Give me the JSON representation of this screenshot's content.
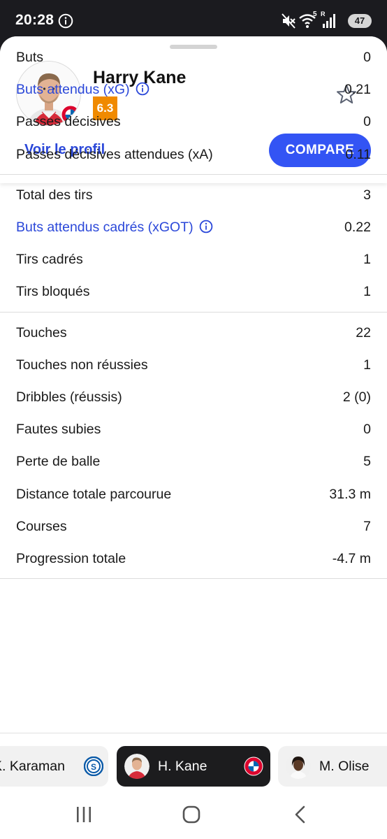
{
  "status_bar": {
    "time": "20:28",
    "battery": "47",
    "network_label": "5",
    "signal_label": "R",
    "icons": [
      "info-icon",
      "mute-icon",
      "wifi-icon",
      "signal-icon",
      "battery-icon"
    ]
  },
  "player": {
    "name": "Harry Kane",
    "rating": "6.3",
    "rating_color": "#f08a00",
    "profile_link": "Voir le profil",
    "compare_label": "COMPARE",
    "favorite_icon": "star-outline-icon"
  },
  "colors": {
    "accent": "#3354f4",
    "link": "#2b48d9",
    "rating_orange": "#f08a00"
  },
  "stat_groups": [
    [
      {
        "label": "Buts",
        "value": "0"
      },
      {
        "label": "Buts attendus (xG)",
        "value": "0.21",
        "link": true
      },
      {
        "label": "Passes décisives",
        "value": "0"
      },
      {
        "label": "Passes décisives attendues (xA)",
        "value": "0.11"
      }
    ],
    [
      {
        "label": "Total des tirs",
        "value": "3"
      },
      {
        "label": "Buts attendus cadrés (xGOT)",
        "value": "0.22",
        "link": true
      },
      {
        "label": "Tirs cadrés",
        "value": "1"
      },
      {
        "label": "Tirs bloqués",
        "value": "1"
      }
    ],
    [
      {
        "label": "Touches",
        "value": "22"
      },
      {
        "label": "Touches non réussies",
        "value": "1"
      },
      {
        "label": "Dribbles (réussis)",
        "value": "2 (0)"
      },
      {
        "label": "Fautes subies",
        "value": "0"
      },
      {
        "label": "Perte de balle",
        "value": "5"
      },
      {
        "label": "Distance totale parcourue",
        "value": "31.3 m"
      },
      {
        "label": "Courses",
        "value": "7"
      },
      {
        "label": "Progression totale",
        "value": "-4.7 m"
      }
    ]
  ],
  "player_switcher": [
    {
      "name": "K. Karaman",
      "crest": "schalke-crest-icon",
      "active": false
    },
    {
      "name": "H. Kane",
      "crest": "bayern-crest-icon",
      "active": true
    },
    {
      "name": "M. Olise",
      "crest": "",
      "active": false
    }
  ],
  "nav_bar": {
    "icons": [
      "recent-apps-icon",
      "home-icon",
      "back-icon"
    ]
  }
}
